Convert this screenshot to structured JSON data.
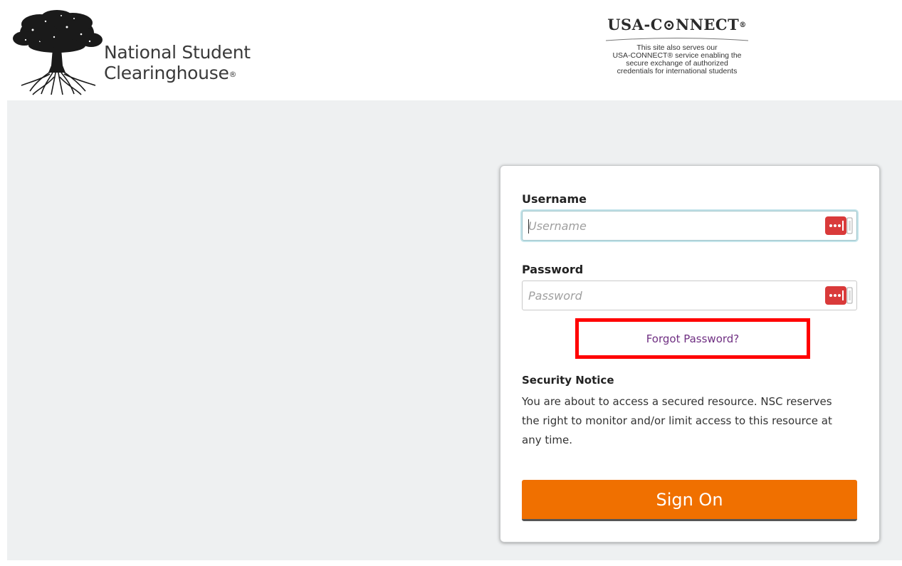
{
  "header": {
    "nsc_logo": {
      "line1": "National Student",
      "line2": "Clearinghouse",
      "registered_mark": "®"
    },
    "usa_connect": {
      "title": "USA-C⊙NNECT",
      "registered_mark": "®",
      "tagline": "This site also serves our\nUSA-CONNECT® service enabling the\nsecure exchange of authorized\ncredentials for international students"
    }
  },
  "login": {
    "username": {
      "label": "Username",
      "placeholder": "Username",
      "value": ""
    },
    "password": {
      "label": "Password",
      "placeholder": "Password",
      "value": ""
    },
    "forgot_password": "Forgot Password?",
    "security_notice": {
      "title": "Security Notice",
      "body": "You are about to access a secured resource. NSC reserves the right to monitor and/or limit access to this resource at any time."
    },
    "sign_on_label": "Sign On"
  },
  "icons": {
    "password_manager": "password-manager-icon",
    "tree": "tree-logo-icon"
  },
  "colors": {
    "sign_on_button": "#f07000",
    "forgot_link": "#6f2f82",
    "highlight_box": "#ff0000",
    "page_background": "#eef0f1",
    "password_manager_icon": "#d93a3a"
  }
}
